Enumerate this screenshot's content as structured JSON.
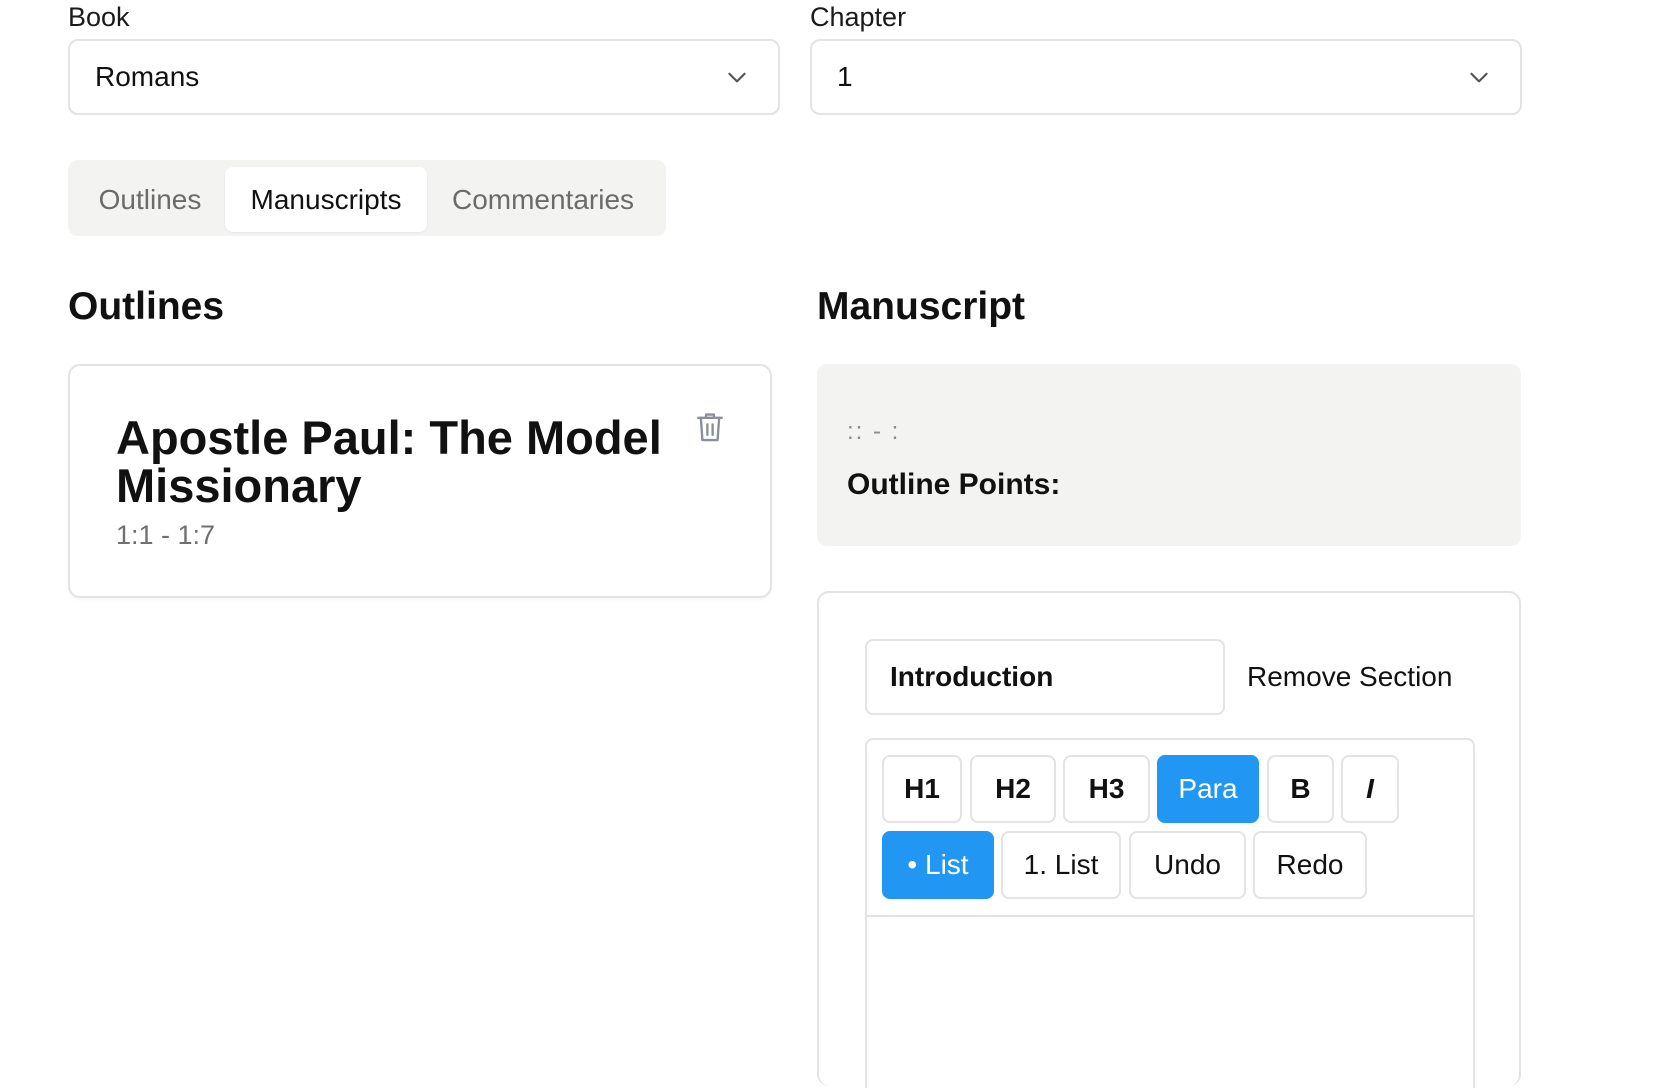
{
  "book": {
    "label": "Book",
    "value": "Romans"
  },
  "chapter": {
    "label": "Chapter",
    "value": "1"
  },
  "tabs": [
    {
      "label": "Outlines",
      "active": false
    },
    {
      "label": "Manuscripts",
      "active": true
    },
    {
      "label": "Commentaries",
      "active": false
    }
  ],
  "outlines": {
    "heading": "Outlines",
    "items": [
      {
        "title": "Apostle Paul: The Model Missionary",
        "range": "1:1 - 1:7"
      }
    ]
  },
  "manuscript": {
    "heading": "Manuscript",
    "reference": ":: - :",
    "points_label": "Outline Points:",
    "section": {
      "name": "Introduction",
      "remove_label": "Remove Section"
    },
    "toolbar": {
      "row1": [
        "H1",
        "H2",
        "H3",
        "Para",
        "B",
        "I"
      ],
      "row2": [
        "• List",
        "1. List",
        "Undo",
        "Redo"
      ],
      "active": [
        "Para",
        "• List"
      ]
    }
  },
  "colors": {
    "accent": "#2196f3",
    "border": "#e3e3e3",
    "panel": "#f3f3f2"
  },
  "icons": {
    "select_chevron": "chevron-down-icon",
    "delete": "trash-icon"
  }
}
